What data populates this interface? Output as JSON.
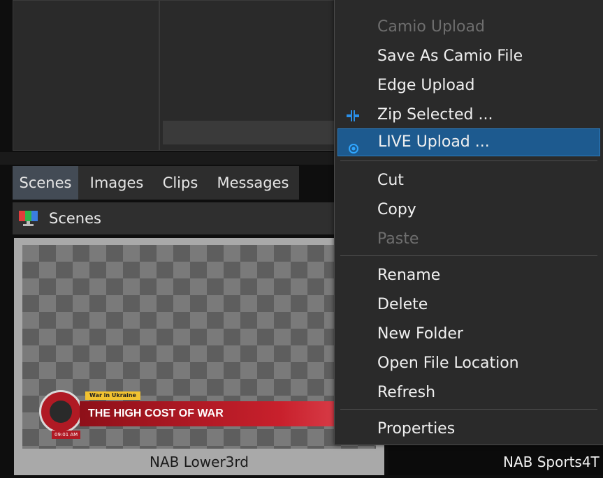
{
  "tabs": [
    "Scenes",
    "Images",
    "Clips",
    "Messages"
  ],
  "scenes_header": {
    "label": "Scenes",
    "icon": "scenes-monitor-icon"
  },
  "thumbnails": [
    {
      "caption": "NAB Lower3rd",
      "overlay": {
        "tag": "War in Ukraine",
        "headline": "THE HIGH COST OF WAR",
        "clock": "09:01 AM"
      }
    },
    {
      "caption": "NAB Sports4T"
    }
  ],
  "context_menu": {
    "items": [
      {
        "label": "Camio Upload",
        "disabled": true
      },
      {
        "label": "Save As Camio File"
      },
      {
        "label": "Edge Upload"
      },
      {
        "label": "Zip Selected ...",
        "icon": "compress-icon"
      },
      {
        "label": "LIVE Upload ...",
        "icon": "live-dot-icon",
        "highlighted": true
      },
      {
        "label": "Cut"
      },
      {
        "label": "Copy"
      },
      {
        "label": "Paste",
        "disabled": true
      },
      {
        "label": "Rename"
      },
      {
        "label": "Delete"
      },
      {
        "label": "New Folder"
      },
      {
        "label": "Open File Location"
      },
      {
        "label": "Refresh"
      },
      {
        "label": "Properties"
      }
    ]
  },
  "colors": {
    "accent": "#1d5a8f",
    "icon_blue": "#2b8fe8",
    "lower_third_red": "#c8202c"
  }
}
